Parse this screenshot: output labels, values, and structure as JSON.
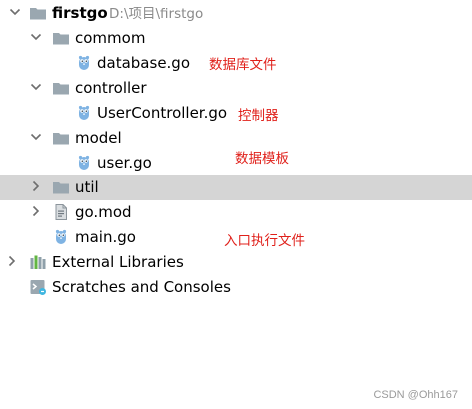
{
  "project": {
    "name": "firstgo",
    "path": "D:\\项目\\firstgo"
  },
  "tree": {
    "commom": "commom",
    "database_go": "database.go",
    "controller": "controller",
    "user_controller_go": "UserController.go",
    "model": "model",
    "user_go": "user.go",
    "util": "util",
    "go_mod": "go.mod",
    "main_go": "main.go",
    "external_libraries": "External Libraries",
    "scratches": "Scratches and Consoles"
  },
  "annotations": {
    "database": "数据库文件",
    "controller": "控制器",
    "model": "数据模板",
    "main": "入口执行文件",
    "color": "#e0211b"
  },
  "watermark": "CSDN @Ohh167",
  "colors": {
    "folder": "#9aa7b0",
    "selection": "#d5d5d5",
    "gopher": "#7fb3e3",
    "chevron": "#6e6e6e"
  }
}
